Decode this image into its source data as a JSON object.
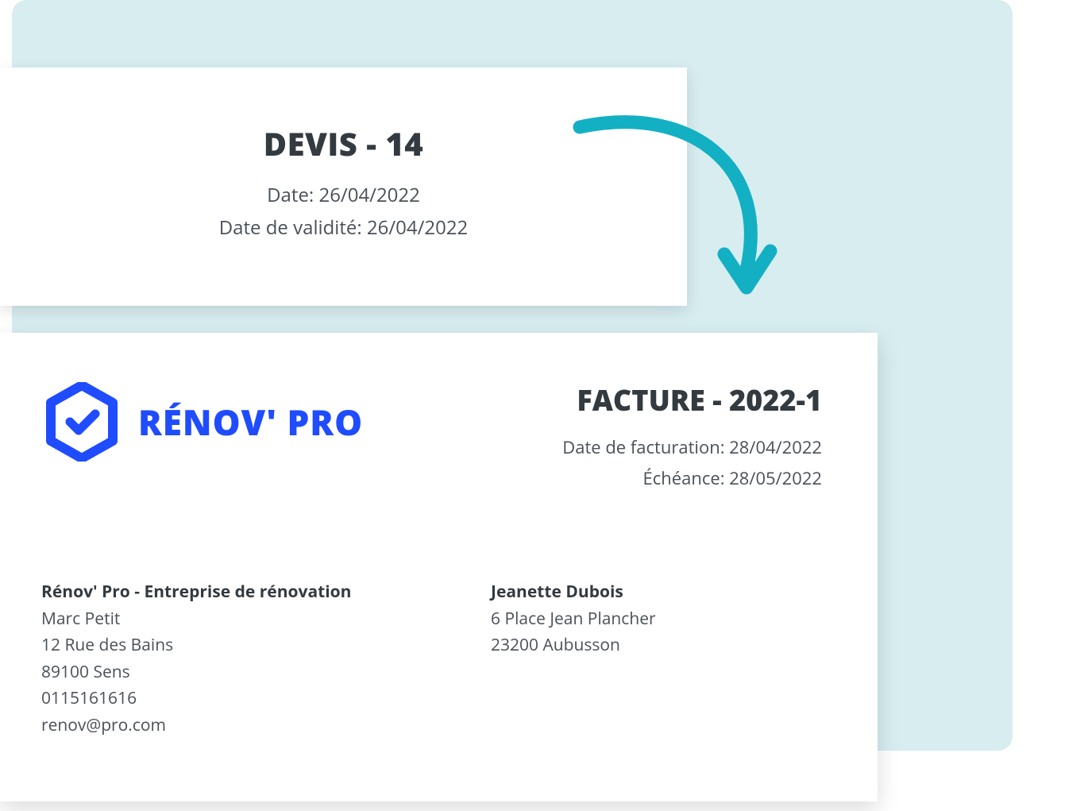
{
  "devis": {
    "title": "DEVIS - 14",
    "date_label": "Date:",
    "date_value": "26/04/2022",
    "validity_label": "Date de validité:",
    "validity_value": "26/04/2022"
  },
  "facture": {
    "title": "FACTURE - 2022-1",
    "billing_date_label": "Date de facturation:",
    "billing_date_value": "28/04/2022",
    "due_label": "Échéance:",
    "due_value": "28/05/2022"
  },
  "logo": {
    "text": "RÉNOV' PRO"
  },
  "company": {
    "name": "Rénov' Pro - Entreprise de rénovation",
    "contact": "Marc Petit",
    "street": "12 Rue des Bains",
    "city": "89100 Sens",
    "phone": "0115161616",
    "email": "renov@pro.com"
  },
  "client": {
    "name": "Jeanette Dubois",
    "street": "6 Place Jean Plancher",
    "city": "23200 Aubusson"
  }
}
